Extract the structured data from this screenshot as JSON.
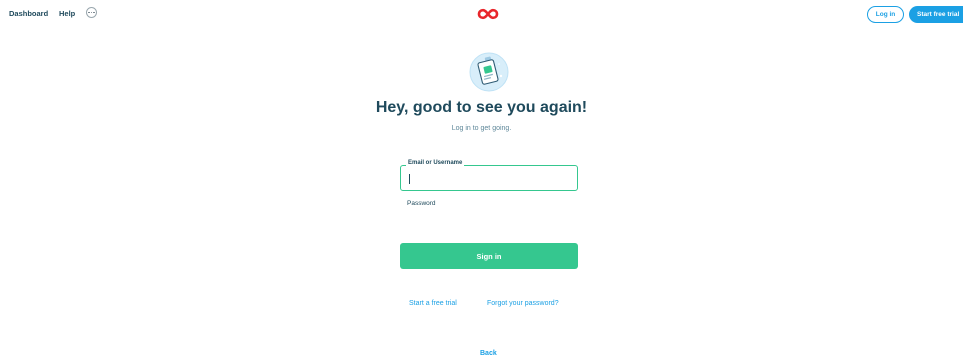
{
  "nav": {
    "dashboard": "Dashboard",
    "help": "Help"
  },
  "header": {
    "login": "Log in",
    "start_trial": "Start free trial"
  },
  "login": {
    "title": "Hey, good to see you again!",
    "subtitle": "Log in to get going.",
    "email_label": "Email or Username",
    "email_value": "",
    "password_label": "Password",
    "sign_in": "Sign in",
    "start_trial_link": "Start a free trial",
    "forgot_password_link": "Forgot your password?",
    "back": "Back"
  },
  "colors": {
    "accent_blue": "#1ba0e4",
    "accent_green": "#35c78f",
    "text_dark": "#1f4a5c",
    "logo_red": "#e8262b"
  },
  "icons": {
    "more": "more-horizontal-icon",
    "logo": "infinity-logo-icon",
    "hero": "id-badge-illustration-icon"
  }
}
